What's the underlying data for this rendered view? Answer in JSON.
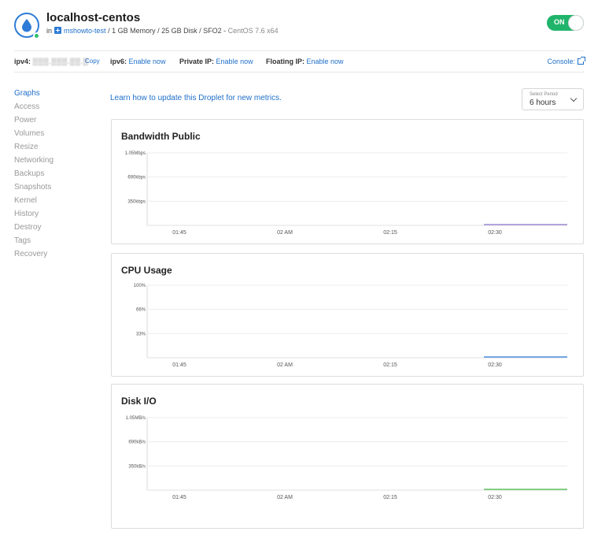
{
  "header": {
    "title": "localhost-centos",
    "in_label": "in",
    "project": "mshowto-test",
    "specs": "/ 1 GB Memory / 25 GB Disk / SFO2 -",
    "os": "CentOS 7.6 x64",
    "power_toggle": "ON"
  },
  "infobar": {
    "ipv4_label": "ipv4:",
    "ipv4_value": "▒▒▒.▒▒▒.▒▒.▒",
    "copy": "Copy",
    "ipv6_label": "ipv6:",
    "ipv6_action": "Enable now",
    "private_label": "Private IP:",
    "private_action": "Enable now",
    "floating_label": "Floating IP:",
    "floating_action": "Enable now",
    "console": "Console:"
  },
  "sidenav": {
    "items": [
      "Graphs",
      "Access",
      "Power",
      "Volumes",
      "Resize",
      "Networking",
      "Backups",
      "Snapshots",
      "Kernel",
      "History",
      "Destroy",
      "Tags",
      "Recovery"
    ]
  },
  "metrics_link": "Learn how to update this Droplet for new metrics.",
  "period": {
    "caption": "Select Period",
    "value": "6 hours"
  },
  "colors": {
    "accent": "#1f6fc9",
    "on": "#20b46a",
    "bandwidth_line": "#9b8ad1",
    "cpu_line": "#4b8fe0",
    "disk_line": "#62c462"
  },
  "chart_data": [
    {
      "type": "line",
      "title": "Bandwidth Public",
      "y_ticks": [
        "1.05Mbps",
        "690kbps",
        "350kbps"
      ],
      "x_ticks": [
        "01:45",
        "02 AM",
        "02:15",
        "02:30"
      ],
      "series": [
        {
          "x": [
            "02:30",
            "02:45"
          ],
          "values": [
            0,
            0
          ]
        }
      ]
    },
    {
      "type": "line",
      "title": "CPU Usage",
      "y_ticks": [
        "100%",
        "66%",
        "33%"
      ],
      "x_ticks": [
        "01:45",
        "02 AM",
        "02:15",
        "02:30"
      ],
      "series": [
        {
          "x": [
            "02:30",
            "02:45"
          ],
          "values": [
            0,
            0
          ]
        }
      ]
    },
    {
      "type": "line",
      "title": "Disk I/O",
      "y_ticks": [
        "1.05MB/s",
        "690kB/s",
        "350kB/s"
      ],
      "x_ticks": [
        "01:45",
        "02 AM",
        "02:15",
        "02:30"
      ],
      "series": [
        {
          "x": [
            "02:30",
            "02:45"
          ],
          "values": [
            0,
            0
          ]
        }
      ]
    }
  ]
}
